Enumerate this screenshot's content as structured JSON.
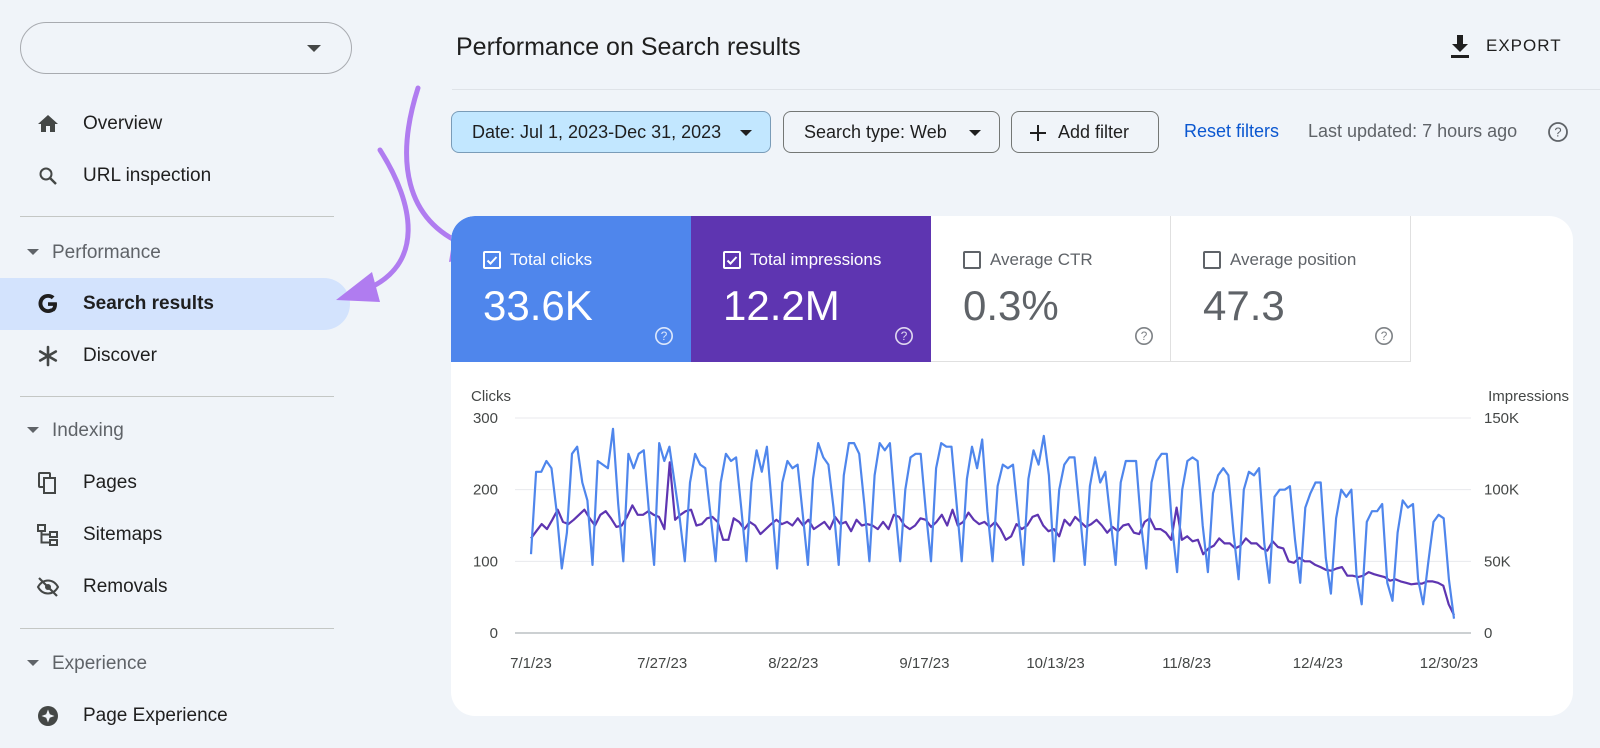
{
  "sidebar": {
    "property_value": "",
    "items": [
      {
        "label": "Overview",
        "icon": "home-icon"
      },
      {
        "label": "URL inspection",
        "icon": "search-icon"
      },
      {
        "label": "Search results",
        "icon": "google-g-icon",
        "active": true
      },
      {
        "label": "Discover",
        "icon": "asterisk-icon"
      },
      {
        "label": "Pages",
        "icon": "pages-icon"
      },
      {
        "label": "Sitemaps",
        "icon": "sitemap-icon"
      },
      {
        "label": "Removals",
        "icon": "eye-off-icon"
      },
      {
        "label": "Page Experience",
        "icon": "page-experience-icon"
      }
    ],
    "sections": {
      "performance": "Performance",
      "indexing": "Indexing",
      "experience": "Experience"
    }
  },
  "header": {
    "title": "Performance on Search results",
    "export_label": "EXPORT"
  },
  "filters": {
    "date": "Date: Jul 1, 2023-Dec 31, 2023",
    "search_type": "Search type: Web",
    "add_filter": "Add filter",
    "reset": "Reset filters",
    "last_updated": "Last updated: 7 hours ago"
  },
  "metrics": [
    {
      "label": "Total clicks",
      "value": "33.6K",
      "checked": true,
      "color": "#4f86ec"
    },
    {
      "label": "Total impressions",
      "value": "12.2M",
      "checked": true,
      "color": "#5e35b1"
    },
    {
      "label": "Average CTR",
      "value": "0.3%",
      "checked": false
    },
    {
      "label": "Average position",
      "value": "47.3",
      "checked": false
    }
  ],
  "colors": {
    "clicks": "#4f86ec",
    "impressions": "#5e35b1",
    "accent": "#0b57d0",
    "active_nav": "#d3e3fd",
    "arrow": "#b07cf0"
  },
  "chart_data": {
    "type": "line",
    "left_axis_label": "Clicks",
    "right_axis_label": "Impressions",
    "left_ylim": [
      0,
      300
    ],
    "right_ylim": [
      0,
      150000
    ],
    "left_ticks": [
      "0",
      "100",
      "200",
      "300"
    ],
    "right_ticks": [
      "0",
      "50K",
      "100K",
      "150K"
    ],
    "x_ticks": [
      "7/1/23",
      "7/27/23",
      "8/22/23",
      "9/17/23",
      "10/13/23",
      "11/8/23",
      "12/4/23",
      "12/30/23"
    ],
    "x_start": "2023-07-01",
    "x_end": "2023-12-31",
    "grid": true,
    "series": [
      {
        "name": "Clicks",
        "axis": "left",
        "values": [
          110,
          225,
          225,
          240,
          230,
          170,
          90,
          140,
          250,
          260,
          210,
          185,
          95,
          240,
          235,
          230,
          285,
          180,
          100,
          250,
          230,
          250,
          255,
          170,
          95,
          265,
          240,
          260,
          210,
          160,
          100,
          210,
          250,
          235,
          230,
          165,
          100,
          210,
          250,
          240,
          245,
          175,
          100,
          210,
          255,
          225,
          260,
          175,
          90,
          210,
          240,
          230,
          235,
          165,
          95,
          215,
          265,
          245,
          235,
          175,
          95,
          220,
          265,
          265,
          250,
          180,
          100,
          220,
          265,
          255,
          265,
          175,
          100,
          200,
          245,
          250,
          250,
          170,
          100,
          230,
          265,
          260,
          260,
          180,
          100,
          215,
          260,
          230,
          270,
          170,
          100,
          205,
          235,
          230,
          235,
          165,
          95,
          215,
          255,
          235,
          275,
          220,
          100,
          200,
          235,
          245,
          245,
          170,
          95,
          205,
          245,
          210,
          225,
          160,
          95,
          210,
          240,
          240,
          240,
          150,
          90,
          210,
          240,
          250,
          250,
          150,
          85,
          200,
          240,
          245,
          240,
          150,
          85,
          195,
          220,
          230,
          220,
          140,
          75,
          200,
          225,
          220,
          230,
          125,
          70,
          190,
          200,
          200,
          205,
          130,
          70,
          175,
          195,
          210,
          210,
          105,
          55,
          160,
          200,
          190,
          200,
          80,
          40,
          155,
          170,
          170,
          180,
          70,
          45,
          140,
          185,
          175,
          180,
          75,
          40,
          100,
          155,
          165,
          160,
          75,
          20
        ]
      },
      {
        "name": "Impressions",
        "axis": "left",
        "values": [
          132,
          142,
          152,
          145,
          158,
          172,
          155,
          152,
          158,
          165,
          172,
          160,
          150,
          165,
          170,
          160,
          148,
          150,
          162,
          178,
          165,
          165,
          170,
          165,
          162,
          145,
          238,
          158,
          165,
          170,
          172,
          150,
          152,
          160,
          162,
          155,
          130,
          130,
          160,
          155,
          145,
          155,
          150,
          138,
          145,
          152,
          158,
          152,
          155,
          150,
          160,
          150,
          158,
          145,
          150,
          155,
          145,
          162,
          152,
          155,
          142,
          158,
          150,
          152,
          150,
          145,
          155,
          145,
          165,
          162,
          150,
          145,
          150,
          160,
          158,
          148,
          155,
          165,
          150,
          172,
          150,
          155,
          168,
          158,
          152,
          155,
          148,
          155,
          145,
          130,
          135,
          152,
          145,
          150,
          162,
          165,
          150,
          142,
          145,
          135,
          158,
          150,
          162,
          155,
          148,
          152,
          158,
          150,
          140,
          148,
          142,
          150,
          152,
          140,
          138,
          155,
          160,
          145,
          145,
          140,
          130,
          175,
          130,
          135,
          128,
          130,
          110,
          118,
          122,
          132,
          125,
          125,
          118,
          122,
          132,
          125,
          125,
          118,
          115,
          128,
          120,
          118,
          100,
          98,
          105,
          100,
          100,
          95,
          92,
          88,
          87,
          90,
          92,
          80,
          80,
          78,
          80,
          85,
          82,
          80,
          78,
          73,
          75,
          72,
          70,
          68,
          69,
          69,
          72,
          72,
          70,
          66,
          40,
          25
        ]
      }
    ]
  }
}
